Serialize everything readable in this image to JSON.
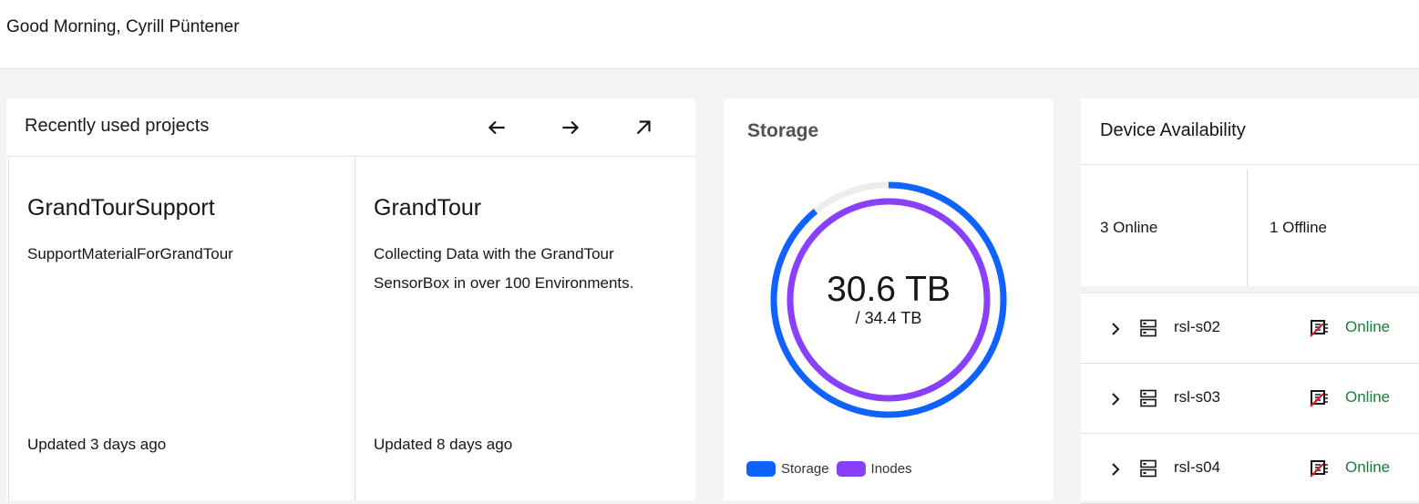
{
  "header": {
    "greeting": "Good Morning, Cyrill Püntener"
  },
  "projects_card": {
    "title": "Recently used projects",
    "controls": {
      "prev_icon": "arrow-left-icon",
      "next_icon": "arrow-right-icon",
      "open_icon": "arrow-up-right-icon"
    },
    "items": [
      {
        "name": "GrandTourSupport",
        "description": "SupportMaterialForGrandTour",
        "updated": "Updated 3 days ago"
      },
      {
        "name": "GrandTour",
        "description": "Collecting Data with the GrandTour SensorBox in over 100 Environments.",
        "updated": "Updated 8 days ago"
      }
    ]
  },
  "storage_card": {
    "title": "Storage",
    "used": "30.6 TB",
    "total": "/ 34.4 TB",
    "storage_fraction": 0.89,
    "inodes_fraction": 1.0,
    "legend": [
      {
        "label": "Storage",
        "color": "#0f62fe"
      },
      {
        "label": "Inodes",
        "color": "#8a3ffc"
      }
    ]
  },
  "device_card": {
    "title": "Device Availability",
    "online_summary": "3 Online",
    "offline_summary": "1 Offline",
    "devices": [
      {
        "name": "rsl-s02",
        "status": "Online",
        "icon": "server-icon",
        "status_icon": "cpu-icon"
      },
      {
        "name": "rsl-s03",
        "status": "Online",
        "icon": "server-icon",
        "status_icon": "cpu-icon"
      },
      {
        "name": "rsl-s04",
        "status": "Online",
        "icon": "server-icon",
        "status_icon": "cpu-icon"
      }
    ]
  },
  "colors": {
    "online": "#198038",
    "storage": "#0f62fe",
    "inodes": "#8a3ffc",
    "track": "#ececec"
  }
}
